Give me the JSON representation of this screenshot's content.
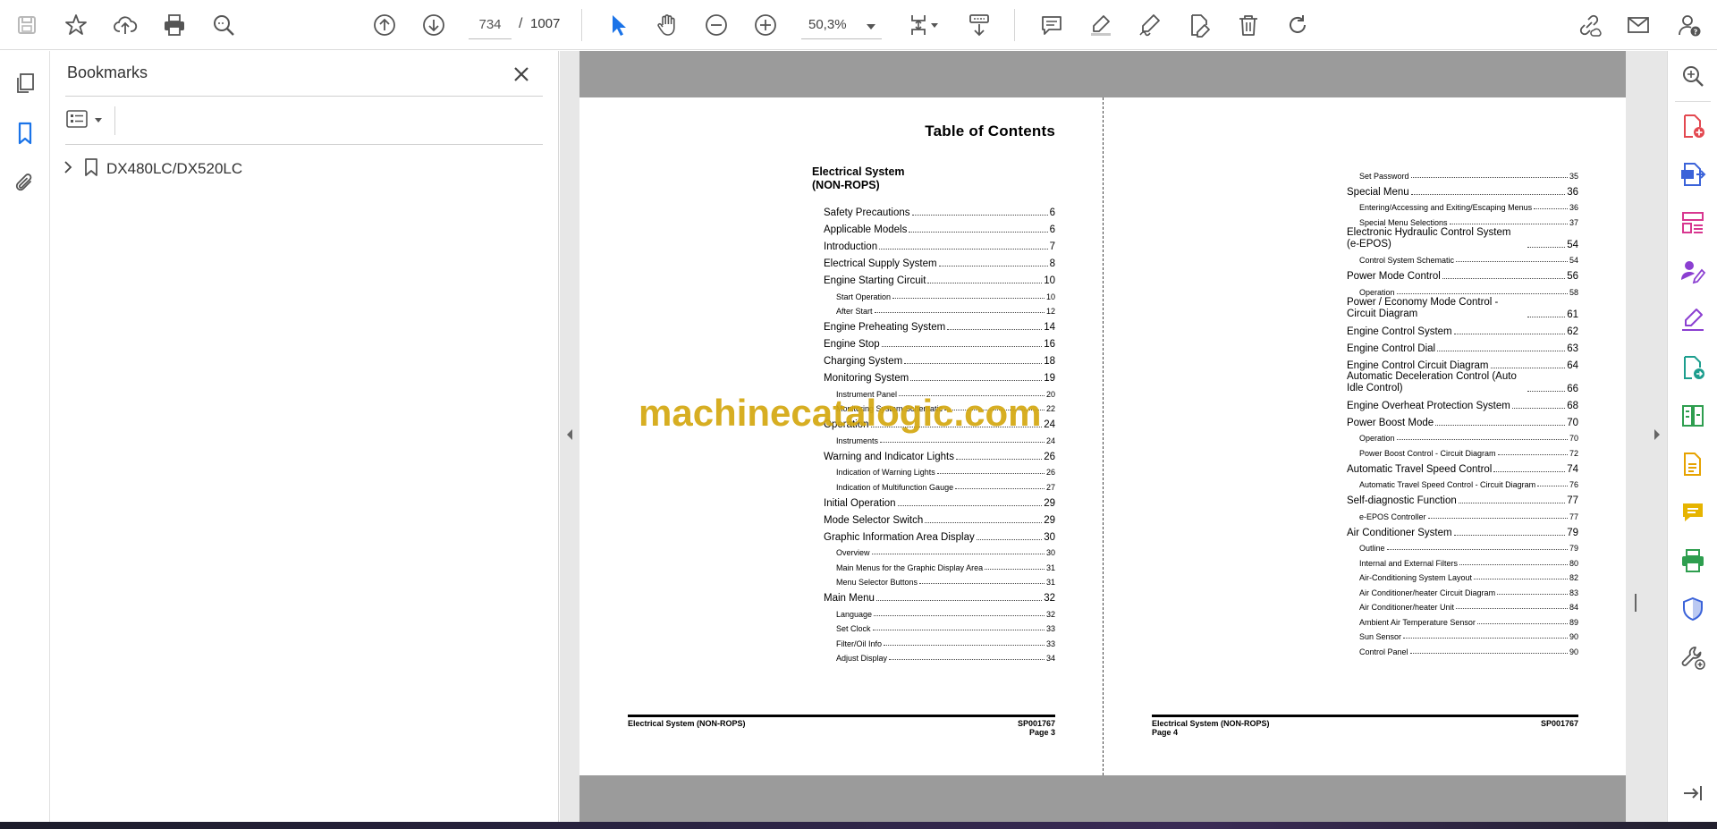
{
  "toolbar": {
    "current_page": "734",
    "page_separator": "/",
    "total_pages": "1007",
    "zoom": "50,3%"
  },
  "bookmarks_panel": {
    "title": "Bookmarks",
    "items": [
      {
        "label": "DX480LC/DX520LC"
      }
    ]
  },
  "watermark": "machinecatalogic.com",
  "page3": {
    "toc_title": "Table of Contents",
    "section_title_line1": "Electrical System",
    "section_title_line2": "(NON-ROPS)",
    "entries": [
      {
        "label": "Safety Precautions",
        "page": "6",
        "level": "main"
      },
      {
        "label": "Applicable Models",
        "page": "6",
        "level": "main"
      },
      {
        "label": "Introduction",
        "page": "7",
        "level": "main"
      },
      {
        "label": "Electrical Supply System",
        "page": "8",
        "level": "main"
      },
      {
        "label": "Engine Starting Circuit",
        "page": "10",
        "level": "main"
      },
      {
        "label": "Start Operation",
        "page": "10",
        "level": "sub"
      },
      {
        "label": "After Start",
        "page": "12",
        "level": "sub"
      },
      {
        "label": "Engine Preheating System",
        "page": "14",
        "level": "main"
      },
      {
        "label": "Engine Stop",
        "page": "16",
        "level": "main"
      },
      {
        "label": "Charging System",
        "page": "18",
        "level": "main"
      },
      {
        "label": "Monitoring System",
        "page": "19",
        "level": "main"
      },
      {
        "label": "Instrument Panel",
        "page": "20",
        "level": "sub"
      },
      {
        "label": "Monitoring System Schematic",
        "page": "22",
        "level": "sub"
      },
      {
        "label": "Operation",
        "page": "24",
        "level": "main"
      },
      {
        "label": "Instruments",
        "page": "24",
        "level": "sub"
      },
      {
        "label": "Warning and Indicator Lights",
        "page": "26",
        "level": "main"
      },
      {
        "label": "Indication of Warning Lights",
        "page": "26",
        "level": "sub"
      },
      {
        "label": "Indication of Multifunction Gauge",
        "page": "27",
        "level": "sub"
      },
      {
        "label": "Initial Operation",
        "page": "29",
        "level": "main"
      },
      {
        "label": "Mode Selector Switch",
        "page": "29",
        "level": "main"
      },
      {
        "label": "Graphic Information Area Display",
        "page": "30",
        "level": "main"
      },
      {
        "label": "Overview",
        "page": "30",
        "level": "sub"
      },
      {
        "label": "Main Menus for the Graphic Display Area",
        "page": "31",
        "level": "sub"
      },
      {
        "label": "Menu Selector Buttons",
        "page": "31",
        "level": "sub"
      },
      {
        "label": "Main Menu",
        "page": "32",
        "level": "main"
      },
      {
        "label": "Language",
        "page": "32",
        "level": "sub"
      },
      {
        "label": "Set Clock",
        "page": "33",
        "level": "sub"
      },
      {
        "label": "Filter/Oil Info",
        "page": "33",
        "level": "sub"
      },
      {
        "label": "Adjust Display",
        "page": "34",
        "level": "sub"
      }
    ],
    "footer_left": "Electrical System (NON-ROPS)",
    "footer_right_line1": "SP001767",
    "footer_right_line2": "Page 3"
  },
  "page4": {
    "entries": [
      {
        "label": "Set Password",
        "page": "35",
        "level": "sub"
      },
      {
        "label": "Special Menu",
        "page": "36",
        "level": "main"
      },
      {
        "label": "Entering/Accessing and Exiting/Escaping Menus",
        "page": "36",
        "level": "sub"
      },
      {
        "label": "Special Menu Selections",
        "page": "37",
        "level": "sub"
      },
      {
        "label": "Electronic Hydraulic Control System (e-EPOS)",
        "page": "54",
        "level": "main",
        "lines": 2
      },
      {
        "label": "Control System Schematic",
        "page": "54",
        "level": "sub"
      },
      {
        "label": "Power Mode Control",
        "page": "56",
        "level": "main"
      },
      {
        "label": "Operation",
        "page": "58",
        "level": "sub"
      },
      {
        "label": "Power /  Economy Mode Control - Circuit Diagram",
        "page": "61",
        "level": "main",
        "lines": 2
      },
      {
        "label": "Engine Control System",
        "page": "62",
        "level": "main"
      },
      {
        "label": "Engine Control Dial",
        "page": "63",
        "level": "main"
      },
      {
        "label": "Engine Control Circuit Diagram",
        "page": "64",
        "level": "main"
      },
      {
        "label": "Automatic Deceleration Control (Auto Idle Control)",
        "page": "66",
        "level": "main",
        "lines": 2
      },
      {
        "label": "Engine Overheat Protection System",
        "page": "68",
        "level": "main"
      },
      {
        "label": "Power Boost Mode",
        "page": "70",
        "level": "main"
      },
      {
        "label": "Operation",
        "page": "70",
        "level": "sub"
      },
      {
        "label": "Power Boost Control - Circuit Diagram",
        "page": "72",
        "level": "sub"
      },
      {
        "label": "Automatic Travel Speed Control",
        "page": "74",
        "level": "main"
      },
      {
        "label": "Automatic Travel Speed Control - Circuit Diagram",
        "page": "76",
        "level": "sub"
      },
      {
        "label": "Self-diagnostic Function",
        "page": "77",
        "level": "main"
      },
      {
        "label": "e-EPOS Controller",
        "page": "77",
        "level": "sub"
      },
      {
        "label": "Air Conditioner System",
        "page": "79",
        "level": "main"
      },
      {
        "label": "Outline",
        "page": "79",
        "level": "sub"
      },
      {
        "label": "Internal and External Filters",
        "page": "80",
        "level": "sub"
      },
      {
        "label": "Air-Conditioning System Layout",
        "page": "82",
        "level": "sub"
      },
      {
        "label": "Air Conditioner/heater Circuit Diagram",
        "page": "83",
        "level": "sub"
      },
      {
        "label": "Air Conditioner/heater Unit",
        "page": "84",
        "level": "sub"
      },
      {
        "label": "Ambient Air Temperature Sensor",
        "page": "89",
        "level": "sub"
      },
      {
        "label": "Sun Sensor",
        "page": "90",
        "level": "sub"
      },
      {
        "label": "Control Panel",
        "page": "90",
        "level": "sub"
      }
    ],
    "footer_left_line1": "Electrical System (NON-ROPS)",
    "footer_left_line2": "Page 4",
    "footer_right": "SP001767"
  }
}
